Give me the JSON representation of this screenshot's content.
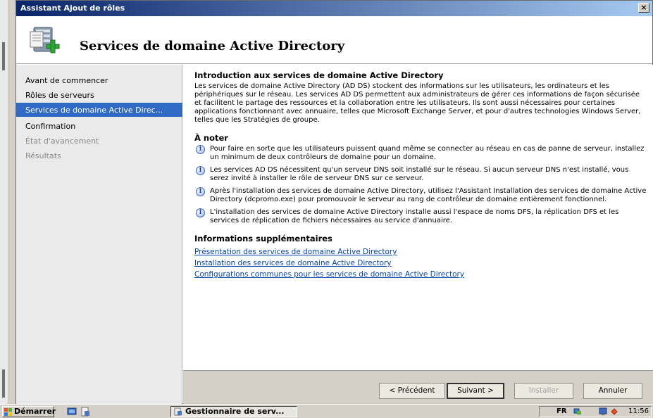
{
  "window": {
    "title": "Assistant Ajout de rôles",
    "close_glyph": "×",
    "header_title": "Services de domaine Active Directory",
    "header_icon": "server-add-icon"
  },
  "sidebar": {
    "items": [
      {
        "label": "Avant de commencer",
        "state": "normal"
      },
      {
        "label": "Rôles de serveurs",
        "state": "normal"
      },
      {
        "label": "Services de domaine Active Direc...",
        "state": "active"
      },
      {
        "label": "Confirmation",
        "state": "normal"
      },
      {
        "label": "État d'avancement",
        "state": "disabled"
      },
      {
        "label": "Résultats",
        "state": "disabled"
      }
    ]
  },
  "content": {
    "intro_heading": "Introduction aux services de domaine Active Directory",
    "intro_text": "Les services de domaine Active Directory (AD DS) stockent des informations sur les utilisateurs, les ordinateurs et les périphériques sur le réseau. Les services AD DS permettent aux administrateurs de gérer ces informations de façon sécurisée et facilitent le partage des ressources et la collaboration entre les utilisateurs. Ils sont aussi nécessaires pour certaines applications fonctionnant avec annuaire, telles que Microsoft Exchange Server, et pour d'autres technologies Windows Server, telles que les Stratégies de groupe.",
    "notes_heading": "À noter",
    "notes": [
      "Pour faire en sorte que les utilisateurs puissent quand même se connecter au réseau en cas de panne de serveur, installez un minimum de deux contrôleurs de domaine pour un domaine.",
      "Les services AD DS nécessitent qu'un serveur DNS soit installé sur le réseau. Si aucun serveur DNS n'est installé, vous serez invité à installer le rôle de serveur DNS sur ce serveur.",
      "Après l'installation des services de domaine Active Directory, utilisez l'Assistant Installation des services de domaine Active Directory (dcpromo.exe) pour promouvoir le serveur au rang de contrôleur de domaine entièrement fonctionnel.",
      "L'installation des services de domaine Active Directory installe aussi l'espace de noms DFS, la réplication DFS et les services de réplication de fichiers nécessaires au service d'annuaire."
    ],
    "more_heading": "Informations supplémentaires",
    "links": [
      "Présentation des services de domaine Active Directory",
      "Installation des services de domaine Active Directory",
      "Configurations communes pour les services de domaine Active Directory"
    ]
  },
  "buttons": {
    "previous": "< Précédent",
    "next": "Suivant >",
    "install": "Installer",
    "cancel": "Annuler"
  },
  "taskbar": {
    "start_label": "Démarrer",
    "task_label": "Gestionnaire de serv...",
    "language": "FR",
    "clock": "11:56"
  },
  "colors": {
    "titlebar_start": "#0a246a",
    "titlebar_end": "#a6caf0",
    "selection": "#316ac5",
    "link": "#0645ad"
  }
}
